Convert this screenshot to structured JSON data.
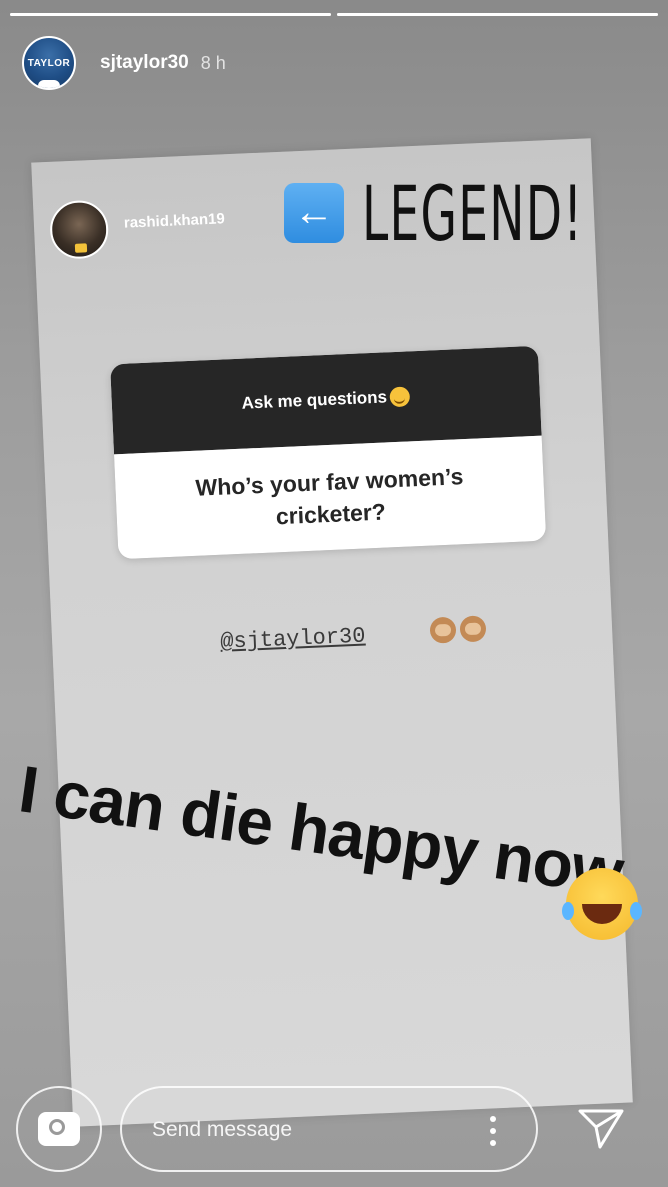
{
  "story": {
    "progress": [
      1.0,
      1.0
    ],
    "header": {
      "username": "sjtaylor30",
      "timeago": "8 h",
      "avatar_text": "TAYLOR"
    }
  },
  "shared_post": {
    "username": "rashid.khan19",
    "question_box": {
      "header": "Ask me questions",
      "question": "Who’s your fav women’s cricketer?"
    },
    "mention": "@sjtaylor30"
  },
  "overlay": {
    "legend": "LEGEND!",
    "caption": "I can die happy now"
  },
  "reply": {
    "placeholder": "Send message"
  },
  "icons": {
    "arrow": "left-arrow-icon",
    "camera": "camera-icon",
    "more": "more-vertical-icon",
    "send": "send-direct-icon"
  }
}
